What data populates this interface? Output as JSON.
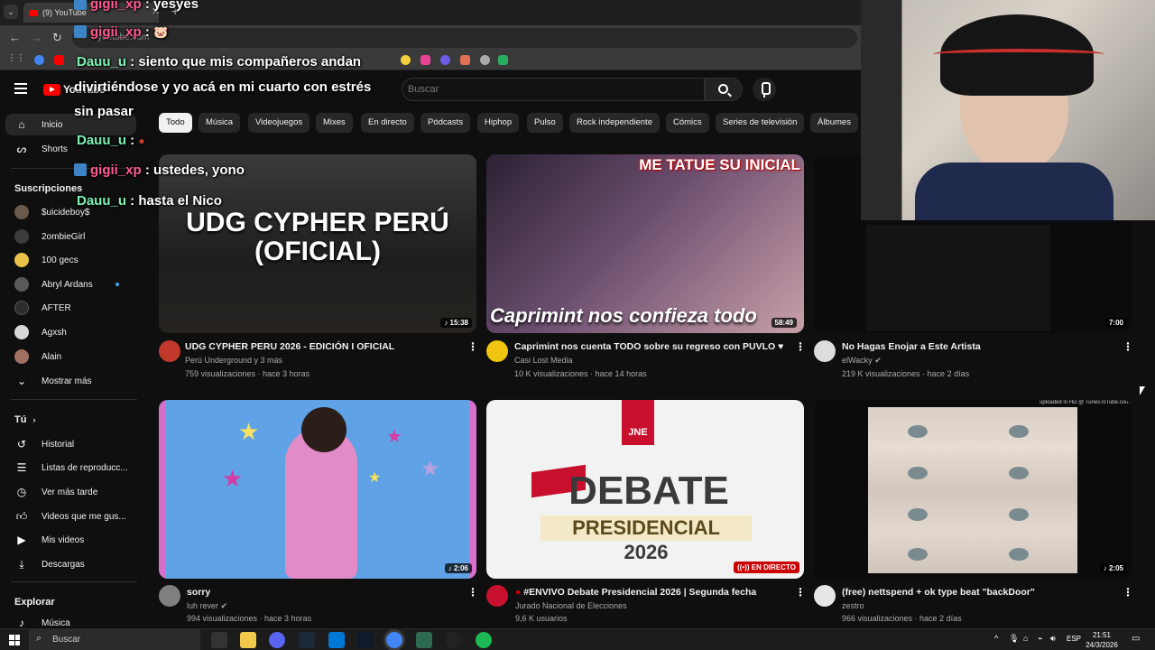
{
  "browser": {
    "tab_title": "(9) YouTube",
    "tab_close": "✕",
    "new_tab": "+",
    "url": "youtube.com"
  },
  "youtube": {
    "logo_text": "YouTube",
    "search_placeholder": "Buscar",
    "chips": [
      "Todo",
      "Música",
      "Videojuegos",
      "Mixes",
      "En directo",
      "Pódcasts",
      "Hiphop",
      "Pulso",
      "Rock independiente",
      "Cómics",
      "Series de televisión",
      "Álbumes"
    ],
    "sidebar": {
      "main": [
        {
          "label": "Inicio",
          "icon": "home-icon"
        },
        {
          "label": "Shorts",
          "icon": "shorts-icon"
        }
      ],
      "subscriptions_title": "Suscripciones",
      "subscriptions": [
        {
          "label": "$uicideboy$",
          "color": "#6b5a4c"
        },
        {
          "label": "2ombieGirl",
          "color": "#3c3c3c"
        },
        {
          "label": "100 gecs",
          "color": "#e8c24a"
        },
        {
          "label": "Abryl Ardans",
          "color": "#5a5a5a"
        },
        {
          "label": "AFTER",
          "color": "#2c2c2c"
        },
        {
          "label": "Agxsh",
          "color": "#d8d8d8"
        },
        {
          "label": "Alain",
          "color": "#a07060"
        }
      ],
      "show_more": "Mostrar más",
      "you_title": "Tú",
      "you_items": [
        {
          "label": "Historial",
          "icon": "history-icon"
        },
        {
          "label": "Listas de reproducc...",
          "icon": "playlists-icon"
        },
        {
          "label": "Ver más tarde",
          "icon": "watch-later-icon"
        },
        {
          "label": "Videos que me gus...",
          "icon": "liked-icon"
        },
        {
          "label": "Mis videos",
          "icon": "my-videos-icon"
        },
        {
          "label": "Descargas",
          "icon": "downloads-icon"
        }
      ],
      "explore_title": "Explorar",
      "explore_items": [
        {
          "label": "Música",
          "icon": "music-icon"
        }
      ]
    },
    "videos": [
      {
        "title": "UDG CYPHER PERU 2026 - EDICIÓN I OFICIAL",
        "channel": "Perú Underground y 3 más",
        "meta": "759 visualizaciones · hace 3 horas",
        "duration": "15:38",
        "thumb_text": "UDG CYPHER PERÚ (OFICIAL)"
      },
      {
        "title": "Caprimint nos cuenta TODO sobre su regreso con PUVLO ♥",
        "channel": "Casi Lost Media",
        "meta": "10 K visualizaciones · hace 14 horas",
        "duration": "58:49",
        "thumb_text_top": "ME TATUE SU INICIAL",
        "thumb_text_bottom": "Caprimint nos confieza todo"
      },
      {
        "title": "No Hagas Enojar a Este Artista",
        "channel": "elWacky",
        "meta": "219 K visualizaciones · hace 2 días",
        "duration": "7:00"
      },
      {
        "title": "sorry",
        "channel": "luh rever",
        "meta": "994 visualizaciones · hace 3 horas",
        "duration": "2:06"
      },
      {
        "title": "#ENVIVO Debate Presidencial 2026 | Segunda fecha",
        "channel": "Jurado Nacional de Elecciones",
        "meta": "9,6 K usuarios",
        "live_badge": "EN DIRECTO",
        "thumb_logo": "JNE",
        "thumb_line1": "DEBATE",
        "thumb_line2": "PRESIDENCIAL",
        "thumb_line3": "2026"
      },
      {
        "title": "(free) nettspend + ok type beat \"backDoor\"",
        "channel": "zestro",
        "meta": "966 visualizaciones · hace 2 días",
        "duration": "2:05",
        "watermark": "uploaded in HD @ TunesToTube.com"
      }
    ]
  },
  "chat": [
    {
      "user": "gigii_xp",
      "text": " : yesyes",
      "color": "pink"
    },
    {
      "user": "gigii_xp",
      "text": " : ",
      "color": "pink"
    },
    {
      "user": "Dauu_u",
      "text": " : siento que mis compañeros andan",
      "color": "green"
    },
    {
      "user": "",
      "text": "divirtiéndose y yo acá en mi cuarto con estrés",
      "color": "none"
    },
    {
      "user": "",
      "text": "sin pasar",
      "color": "none"
    },
    {
      "user": "Dauu_u",
      "text": " : ",
      "color": "green"
    },
    {
      "user": "gigii_xp",
      "text": " : ustedes, yono",
      "color": "pink"
    },
    {
      "user": "Dauu_u",
      "text": " : hasta el Nico",
      "color": "green"
    }
  ],
  "taskbar": {
    "search": "Buscar",
    "lang": "ESP",
    "time": "21:51",
    "date": "24/3/2026"
  }
}
